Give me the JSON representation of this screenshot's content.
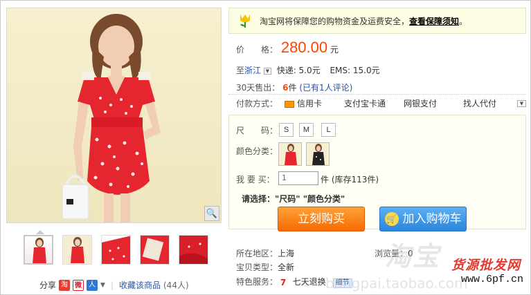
{
  "guarantee": {
    "text": "淘宝网将保障您的购物资金及运费安全，",
    "link": "查看保障须知",
    "end": "。"
  },
  "price": {
    "label": "价　　格：",
    "value": "280.00",
    "unit": "元"
  },
  "shipping": {
    "to": "至",
    "region": "浙江",
    "express": "快递: 5.0元",
    "ems": "EMS: 15.0元"
  },
  "sales": {
    "label": "30天售出：",
    "count": "6",
    "unit": "件",
    "reviews": "(已有1人评论)"
  },
  "payment": {
    "label": "付款方式：",
    "methods": [
      "信用卡",
      "支付宝卡通",
      "网银支付",
      "找人代付"
    ]
  },
  "size": {
    "label": "尺　　码：",
    "options": [
      "S",
      "M",
      "L"
    ]
  },
  "color": {
    "label": "颜色分类："
  },
  "quantity": {
    "label": "我 要 买：",
    "value": "1",
    "unit": "件",
    "stock": "(库存113件)"
  },
  "select_hint": {
    "label": "请选择：",
    "items": "\"尺码\"  \"颜色分类\""
  },
  "buttons": {
    "buy": "立刻购买",
    "cart": "加入购物车"
  },
  "location": {
    "label": "所在地区：",
    "value": "上海"
  },
  "views": {
    "label": "浏览量：",
    "value": "0"
  },
  "item_type": {
    "label": "宝贝类型：",
    "value": "全新"
  },
  "service": {
    "label": "特色服务：",
    "value": "七天退换",
    "tag": "细节"
  },
  "share": {
    "label": "分享",
    "favorite": "收藏该商品",
    "fav_count": "(44人)"
  },
  "watermark": {
    "brand": "货源批发网",
    "url": "www.6pf.cn",
    "site": "bangpai.taobao.com"
  }
}
